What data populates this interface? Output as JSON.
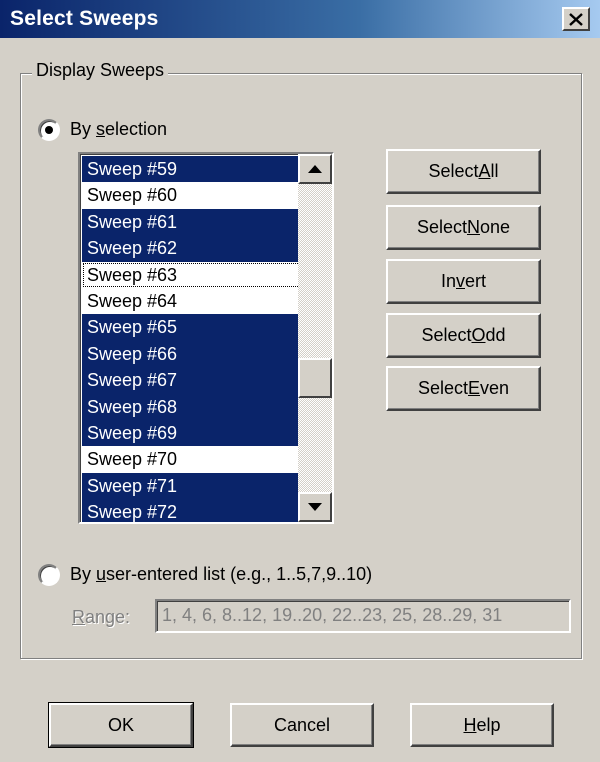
{
  "window": {
    "title": "Select Sweeps",
    "close_icon": "close-icon"
  },
  "group": {
    "legend": "Display Sweeps"
  },
  "by_selection": {
    "label_pre": "By ",
    "label_key": "s",
    "label_post": "election",
    "checked": true
  },
  "sweeps": [
    {
      "label": "Sweep #59",
      "selected": true
    },
    {
      "label": "Sweep #60",
      "selected": false
    },
    {
      "label": "Sweep #61",
      "selected": true
    },
    {
      "label": "Sweep #62",
      "selected": true
    },
    {
      "label": "Sweep #63",
      "selected": false,
      "focused": true
    },
    {
      "label": "Sweep #64",
      "selected": false
    },
    {
      "label": "Sweep #65",
      "selected": true
    },
    {
      "label": "Sweep #66",
      "selected": true
    },
    {
      "label": "Sweep #67",
      "selected": true
    },
    {
      "label": "Sweep #68",
      "selected": true
    },
    {
      "label": "Sweep #69",
      "selected": true
    },
    {
      "label": "Sweep #70",
      "selected": false
    },
    {
      "label": "Sweep #71",
      "selected": true
    },
    {
      "label": "Sweep #72",
      "selected": true
    }
  ],
  "side_buttons": {
    "select_all": {
      "pre": "Select ",
      "key": "A",
      "post": "ll"
    },
    "select_none": {
      "pre": "Select ",
      "key": "N",
      "post": "one"
    },
    "invert": {
      "pre": "In",
      "key": "v",
      "post": "ert"
    },
    "select_odd": {
      "pre": "Select ",
      "key": "O",
      "post": "dd"
    },
    "select_even": {
      "pre": "Select ",
      "key": "E",
      "post": "ven"
    }
  },
  "by_list": {
    "label_pre": "By ",
    "label_key": "u",
    "label_post": "ser-entered list  (e.g., 1..5,7,9..10)",
    "checked": false
  },
  "range": {
    "label_key": "R",
    "label_post": "ange:",
    "value": "1, 4, 6, 8..12, 19..20, 22..23, 25, 28..29, 31"
  },
  "footer": {
    "ok": "OK",
    "cancel": "Cancel",
    "help_key": "H",
    "help_post": "elp"
  },
  "colors": {
    "selection": "#0a246a",
    "face": "#d4d0c8"
  }
}
